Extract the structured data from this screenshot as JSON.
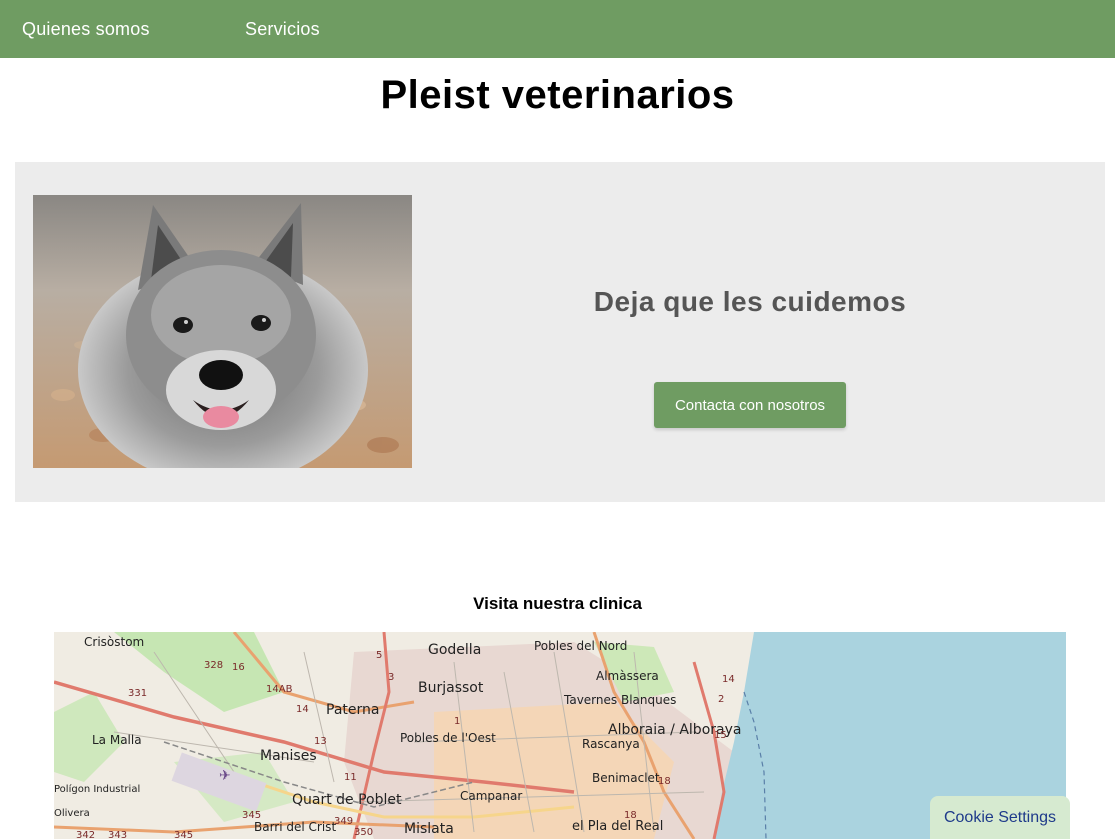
{
  "nav": {
    "items": [
      {
        "label": "Quienes somos"
      },
      {
        "label": "Servicios"
      }
    ]
  },
  "site": {
    "title": "Pleist veterinarios"
  },
  "hero": {
    "heading": "Deja que les cuidemos",
    "button_label": "Contacta con nosotros"
  },
  "map": {
    "heading": "Visita nuestra clinica",
    "places": [
      "Godella",
      "Pobles del Nord",
      "Burjassot",
      "Almàssera",
      "Tavernes Blanques",
      "Paterna",
      "Alboraia / Alboraya",
      "Pobles de l'Oest",
      "La Malla",
      "Manises",
      "Rascanya",
      "Benimaclet",
      "Quart de Poblet",
      "Campanar",
      "Barri del Crist",
      "Mislata",
      "el Pla del Real",
      "Crisòstom",
      "Polígon Industrial",
      "Olivera"
    ],
    "road_numbers": [
      "328",
      "16",
      "331",
      "14AB",
      "14",
      "5",
      "3",
      "1",
      "13",
      "11",
      "345",
      "349",
      "350",
      "342",
      "343",
      "345",
      "14",
      "2",
      "15",
      "18",
      "18"
    ]
  },
  "cookie": {
    "label": "Cookie Settings"
  },
  "colors": {
    "brand_green": "#6f9c62",
    "hero_bg": "#ececec",
    "sea": "#aad3df"
  }
}
